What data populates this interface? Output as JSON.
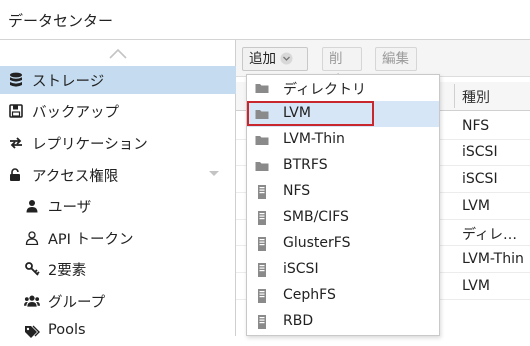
{
  "title": "データセンター",
  "sidebar": {
    "items": [
      {
        "label": "ストレージ",
        "icon": "database-icon",
        "selected": true
      },
      {
        "label": "バックアップ",
        "icon": "floppy-icon"
      },
      {
        "label": "レプリケーション",
        "icon": "replication-icon"
      },
      {
        "label": "アクセス権限",
        "icon": "unlock-icon",
        "expandable": true
      },
      {
        "label": "ユーザ",
        "icon": "user-icon"
      },
      {
        "label": "API トークン",
        "icon": "user-outline-icon"
      },
      {
        "label": "2要素",
        "icon": "key-icon"
      },
      {
        "label": "グループ",
        "icon": "users-icon"
      },
      {
        "label": "Pools",
        "icon": "tags-icon"
      }
    ]
  },
  "toolbar": {
    "add_label": "追加",
    "remove_label": "削除",
    "edit_label": "編集"
  },
  "grid": {
    "type_column": "種別",
    "rows": [
      "NFS",
      "iSCSI",
      "iSCSI",
      "LVM",
      "ディレク...",
      "LVM-Thin",
      "LVM"
    ]
  },
  "add_menu": {
    "items": [
      {
        "label": "ディレクトリ",
        "icon": "folder-icon"
      },
      {
        "label": "LVM",
        "icon": "folder-icon",
        "highlighted": true
      },
      {
        "label": "LVM-Thin",
        "icon": "folder-icon"
      },
      {
        "label": "BTRFS",
        "icon": "folder-icon"
      },
      {
        "label": "NFS",
        "icon": "server-icon"
      },
      {
        "label": "SMB/CIFS",
        "icon": "server-icon"
      },
      {
        "label": "GlusterFS",
        "icon": "server-icon"
      },
      {
        "label": "iSCSI",
        "icon": "server-icon"
      },
      {
        "label": "CephFS",
        "icon": "server-icon"
      },
      {
        "label": "RBD",
        "icon": "server-icon"
      }
    ]
  },
  "colors": {
    "selected_bg": "#c5dcf0",
    "menu_highlight_bg": "#d6e6f6",
    "highlight_frame": "#c8282d"
  }
}
